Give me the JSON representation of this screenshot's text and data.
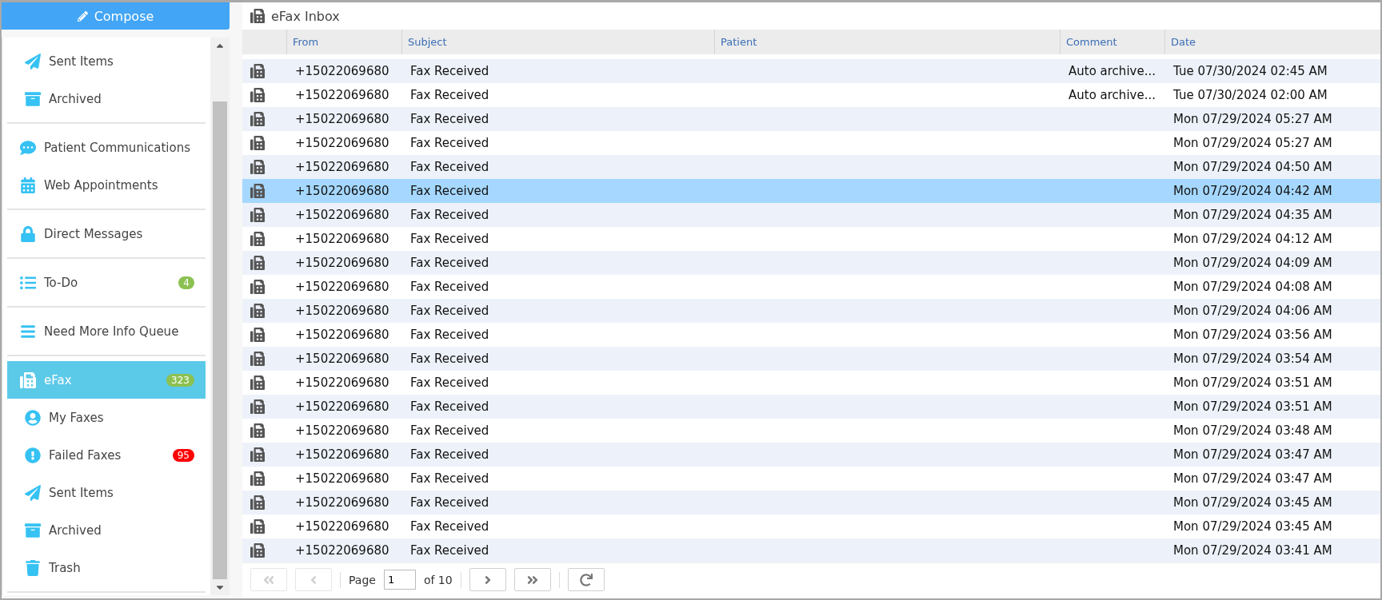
{
  "compose": {
    "label": "Compose"
  },
  "sidebar": {
    "groups": [
      {
        "children": [
          {
            "label": "Sent Items",
            "selected": false
          },
          {
            "label": "Archived",
            "selected": false
          }
        ]
      },
      {
        "items": [
          {
            "label": "Patient Communications",
            "selected": false
          },
          {
            "label": "Web Appointments",
            "selected": false
          }
        ]
      },
      {
        "items": [
          {
            "label": "Direct Messages",
            "selected": false
          }
        ]
      },
      {
        "items": [
          {
            "label": "To-Do",
            "selected": false,
            "badge": "4",
            "color": "#8cc152"
          }
        ]
      },
      {
        "items": [
          {
            "label": "Need More Info Queue",
            "selected": false
          }
        ]
      },
      {
        "items": [
          {
            "label": "eFax",
            "selected": true,
            "badge": "323",
            "color": "#8cc152",
            "children": [
              {
                "label": "My Faxes",
                "selected": false
              },
              {
                "label": "Failed Faxes",
                "selected": false,
                "badge": "95",
                "color": "#ff0000"
              },
              {
                "label": "Sent Items",
                "selected": false
              },
              {
                "label": "Archived",
                "selected": false
              },
              {
                "label": "Trash",
                "selected": false
              }
            ]
          }
        ]
      }
    ]
  },
  "inbox": {
    "title": "eFax Inbox",
    "columns": [
      "From",
      "Subject",
      "Patient",
      "Comment",
      "Date"
    ],
    "rows": [
      {
        "from": "+15022069680",
        "subject": "Fax Received",
        "comment": "Auto archive...",
        "date": "Tue 07/30/2024 02:45 AM",
        "selected": false
      },
      {
        "from": "+15022069680",
        "subject": "Fax Received",
        "comment": "Auto archive...",
        "date": "Tue 07/30/2024 02:00 AM",
        "selected": false
      },
      {
        "from": "+15022069680",
        "subject": "Fax Received",
        "date": "Mon 07/29/2024 05:27 AM",
        "selected": false
      },
      {
        "from": "+15022069680",
        "subject": "Fax Received",
        "date": "Mon 07/29/2024 05:27 AM",
        "selected": false
      },
      {
        "from": "+15022069680",
        "subject": "Fax Received",
        "date": "Mon 07/29/2024 04:50 AM",
        "selected": false
      },
      {
        "from": "+15022069680",
        "subject": "Fax Received",
        "date": "Mon 07/29/2024 04:42 AM",
        "selected": true
      },
      {
        "from": "+15022069680",
        "subject": "Fax Received",
        "date": "Mon 07/29/2024 04:35 AM",
        "selected": false
      },
      {
        "from": "+15022069680",
        "subject": "Fax Received",
        "date": "Mon 07/29/2024 04:12 AM",
        "selected": false
      },
      {
        "from": "+15022069680",
        "subject": "Fax Received",
        "date": "Mon 07/29/2024 04:09 AM",
        "selected": false
      },
      {
        "from": "+15022069680",
        "subject": "Fax Received",
        "date": "Mon 07/29/2024 04:08 AM",
        "selected": false
      },
      {
        "from": "+15022069680",
        "subject": "Fax Received",
        "date": "Mon 07/29/2024 04:06 AM",
        "selected": false
      },
      {
        "from": "+15022069680",
        "subject": "Fax Received",
        "date": "Mon 07/29/2024 03:56 AM",
        "selected": false
      },
      {
        "from": "+15022069680",
        "subject": "Fax Received",
        "date": "Mon 07/29/2024 03:54 AM",
        "selected": false
      },
      {
        "from": "+15022069680",
        "subject": "Fax Received",
        "date": "Mon 07/29/2024 03:51 AM",
        "selected": false
      },
      {
        "from": "+15022069680",
        "subject": "Fax Received",
        "date": "Mon 07/29/2024 03:51 AM",
        "selected": false
      },
      {
        "from": "+15022069680",
        "subject": "Fax Received",
        "date": "Mon 07/29/2024 03:48 AM",
        "selected": false
      },
      {
        "from": "+15022069680",
        "subject": "Fax Received",
        "date": "Mon 07/29/2024 03:47 AM",
        "selected": false
      },
      {
        "from": "+15022069680",
        "subject": "Fax Received",
        "date": "Mon 07/29/2024 03:47 AM",
        "selected": false
      },
      {
        "from": "+15022069680",
        "subject": "Fax Received",
        "date": "Mon 07/29/2024 03:45 AM",
        "selected": false
      },
      {
        "from": "+15022069680",
        "subject": "Fax Received",
        "date": "Mon 07/29/2024 03:45 AM",
        "selected": false
      },
      {
        "from": "+15022069680",
        "subject": "Fax Received",
        "date": "Mon 07/29/2024 03:41 AM",
        "selected": false
      }
    ]
  },
  "pager": {
    "first_disabled": true,
    "prev_disabled": true,
    "next_disabled": false,
    "last_disabled": false,
    "page_label": "Page",
    "page": "1",
    "of": "of 10"
  }
}
